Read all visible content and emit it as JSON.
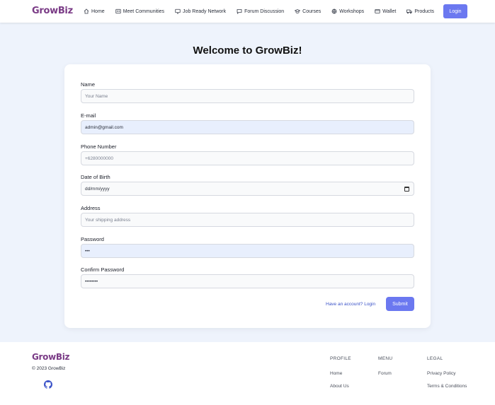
{
  "header": {
    "logo": "GrowBiz",
    "nav": [
      {
        "label": "Home",
        "icon": "home-icon"
      },
      {
        "label": "Meet Communities",
        "icon": "communities-icon"
      },
      {
        "label": "Job Ready Network",
        "icon": "monitor-icon"
      },
      {
        "label": "Forum Discussion",
        "icon": "chat-icon"
      },
      {
        "label": "Courses",
        "icon": "graduation-cap-icon"
      },
      {
        "label": "Workshops",
        "icon": "globe-icon"
      },
      {
        "label": "Wallet",
        "icon": "wallet-icon"
      },
      {
        "label": "Products",
        "icon": "truck-icon"
      }
    ],
    "login_label": "Login"
  },
  "form": {
    "title": "Welcome to GrowBiz!",
    "fields": {
      "name": {
        "label": "Name",
        "placeholder": "Your Name",
        "value": ""
      },
      "email": {
        "label": "E-mail",
        "value": "admin@gmail.com"
      },
      "phone": {
        "label": "Phone Number",
        "placeholder": "+6280000000",
        "value": ""
      },
      "dob": {
        "label": "Date of Birth",
        "value": "dd/mm/yyyy"
      },
      "address": {
        "label": "Address",
        "placeholder": "Your shipping address",
        "value": ""
      },
      "password": {
        "label": "Password",
        "value": "•••"
      },
      "confirm_password": {
        "label": "Confirm Password",
        "value": "••••••••"
      }
    },
    "have_account_link": "Have an account? Login",
    "submit_label": "Submit"
  },
  "footer": {
    "logo": "GrowBiz",
    "copyright": "© 2023 GrowBiz",
    "columns": {
      "profile": {
        "heading": "PROFILE",
        "links": [
          "Home",
          "About Us"
        ]
      },
      "menu": {
        "heading": "MENU",
        "links": [
          "Forum"
        ]
      },
      "legal": {
        "heading": "LEGAL",
        "links": [
          "Privacy Policy",
          "Terms & Conditions"
        ]
      }
    }
  },
  "colors": {
    "brand": "#7a3b86",
    "accent": "#6b78f0",
    "background": "#eef3fc"
  }
}
